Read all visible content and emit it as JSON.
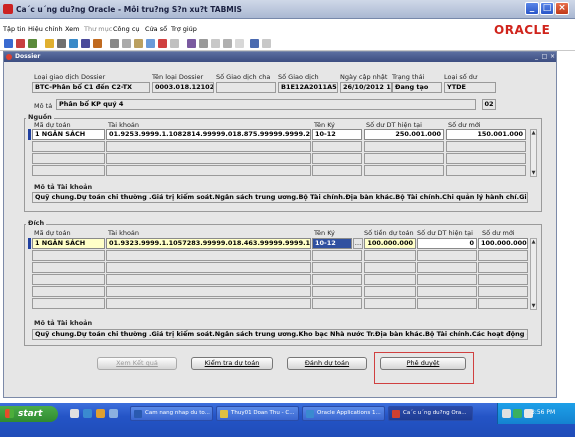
{
  "window": {
    "title": "Ca´c u´ng du?ng Oracle - Môi tru?ng S?n xu?t TABMIS",
    "brand": "ORACLE"
  },
  "menu": [
    "Tập tin",
    "Hiệu chỉnh",
    "Xem",
    "Thư mục",
    "Công cụ",
    "Cửa sổ",
    "Trợ giúp"
  ],
  "form": {
    "title": "Dossier",
    "labels": {
      "type": "Loại giao dịch Dossier",
      "type_name": "Tên loại Dossier",
      "parent": "Số Giao dịch cha",
      "number": "Số Giao dịch",
      "updated": "Ngày cập nhật",
      "status": "Trạng thái",
      "balance_type": "Loại số dư",
      "description": "Mô tả"
    },
    "values": {
      "type": "BTC-Phân bổ C1 đến C2-TX",
      "type_name": "0003.018.121026.k",
      "parent": "",
      "number": "B1E12A2011A52",
      "updated": "26/10/2012 10:1",
      "status": "Đang tạo",
      "balance_type": "YTDE",
      "description": "Phân bổ KP quý 4",
      "counter": "02"
    }
  },
  "source": {
    "section_title": "Nguồn",
    "headers": {
      "budget": "Mã dự toán",
      "account": "Tài khoản",
      "name": "Tên Ký",
      "current": "Số dư DT hiện tại",
      "new": "Số dư mới"
    },
    "row": {
      "budget": "1 NGÂN SÁCH",
      "account": "01.9253.9999.1.1082814.99999.018.875.99999.9999.29.000",
      "name": "10-12",
      "current": "250.001.000",
      "new": "150.001.000"
    },
    "desc_title": "Mô tả Tài khoản",
    "desc": "Quỹ chung.Dự toán chi thường .Giá trị kiểm soát.Ngân sách trung ương.Bộ Tài chính.Địa bàn khác.Bộ Tài chính.Chi quản lý hành chí.Giá trị kiểm"
  },
  "dest": {
    "section_title": "Đích",
    "headers": {
      "budget": "Mã dự toán",
      "account": "Tài khoản",
      "name": "Tên Ký",
      "amount": "Số tiền dự toán",
      "current": "Số dư DT hiện tại",
      "new": "Số dư mới"
    },
    "row": {
      "budget": "1 NGÂN SÁCH",
      "account": "01.9323.9999.1.1057283.99999.018.463.99999.9999.13.000",
      "name": "10-12",
      "amount": "100.000.000",
      "current": "0",
      "new": "100.000.000"
    },
    "desc_title": "Mô tả Tài khoản",
    "desc": "Quỹ chung.Dự toán chi thường .Giá trị kiểm soát.Ngân sách trung ương.Kho bạc Nhà nước Tr.Địa bàn khác.Bộ Tài chính.Các hoạt động quả.Gia"
  },
  "buttons": {
    "view_result": "Xem Kết quả",
    "check": "Kiểm tra dự toán",
    "evaluate": "Đánh dự toán",
    "approve": "Phê duyệt"
  },
  "taskbar": {
    "start": "start",
    "tasks": [
      "Cam nang nhap du to...",
      "Thuy01 Doan Thu - C...",
      "Oracle Applications 1...",
      "Ca´c u´ng du?ng Ora..."
    ],
    "clock": "3:56 PM"
  }
}
